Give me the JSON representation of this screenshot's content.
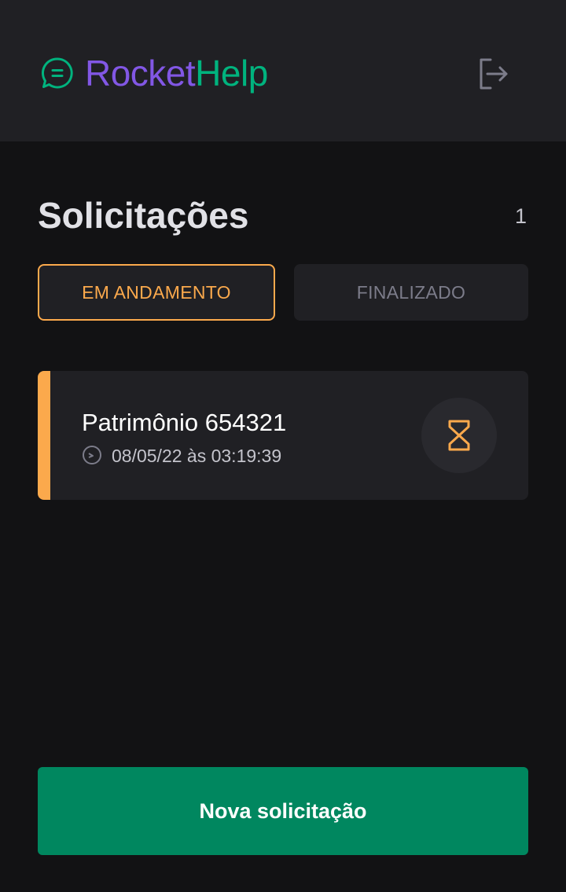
{
  "header": {
    "logo_part1": "Rocket",
    "logo_part2": "Help",
    "logo_icon": "chat-bubble-icon",
    "logout_icon": "sign-out-icon"
  },
  "main": {
    "title": "Solicitações",
    "count": "1"
  },
  "filters": {
    "open_label": "EM ANDAMENTO",
    "closed_label": "FINALIZADO",
    "selected": "open"
  },
  "orders": [
    {
      "title": "Patrimônio 654321",
      "date": "08/05/22 às 03:19:39",
      "status": "open",
      "status_icon": "hourglass-icon",
      "clock_icon": "clock-icon"
    }
  ],
  "footer": {
    "new_button_label": "Nova solicitação"
  },
  "colors": {
    "brand_purple": "#8257e5",
    "brand_green": "#00b37e",
    "accent_open": "#fba94c",
    "button_green": "#00875f",
    "background": "#121214",
    "surface": "#202024"
  }
}
